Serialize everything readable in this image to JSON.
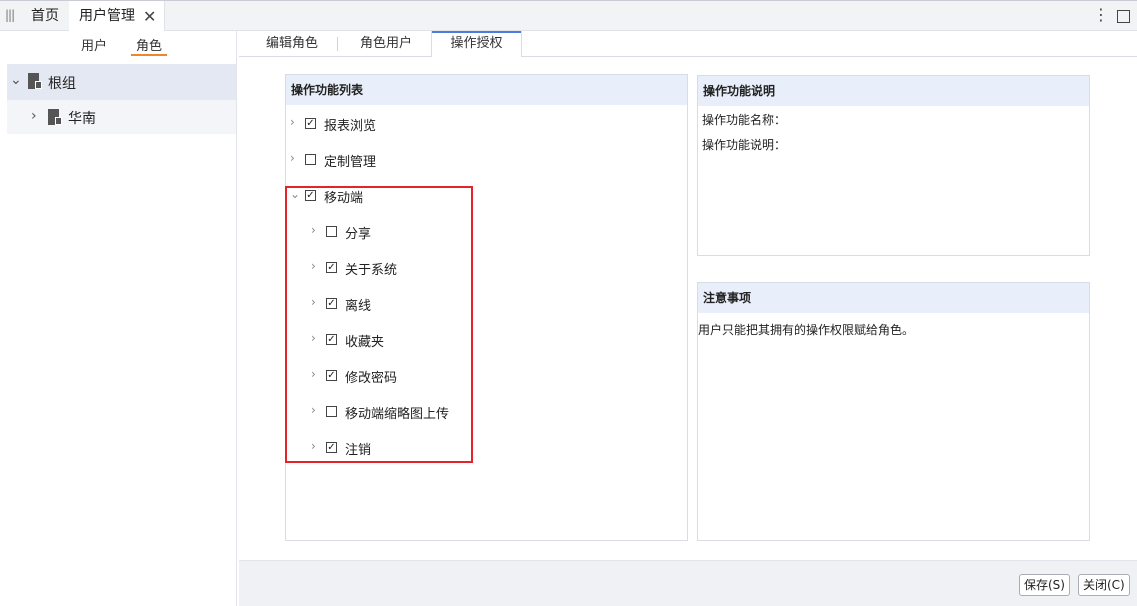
{
  "topbar": {
    "grip_icon": "grip-icon",
    "tabs": [
      {
        "label": "首页"
      },
      {
        "label": "用户管理",
        "close": "✕"
      }
    ],
    "menu_icon": "⋮"
  },
  "left": {
    "subtabs": {
      "users": "用户",
      "roles": "角色"
    },
    "tree": {
      "root": {
        "label": "根组",
        "arrow": "⌄"
      },
      "child": {
        "label": "华南",
        "arrow": "›"
      }
    }
  },
  "content": {
    "tabs": {
      "edit_role": "编辑角色",
      "role_users": "角色用户",
      "permissions": "操作授权"
    },
    "feature_panel": {
      "title": "操作功能列表",
      "items": [
        {
          "label": "报表浏览",
          "checked": "☑",
          "chevron": "›"
        },
        {
          "label": "定制管理",
          "checked": "",
          "chevron": "›"
        },
        {
          "label": "移动端",
          "checked": "☑",
          "chevron": "⌄"
        },
        {
          "label": "分享",
          "checked": "",
          "chevron": "›"
        },
        {
          "label": "关于系统",
          "checked": "☑",
          "chevron": "›"
        },
        {
          "label": "离线",
          "checked": "☑",
          "chevron": "›"
        },
        {
          "label": "收藏夹",
          "checked": "☑",
          "chevron": "›"
        },
        {
          "label": "修改密码",
          "checked": "☑",
          "chevron": "›"
        },
        {
          "label": "移动端缩略图上传",
          "checked": "",
          "chevron": "›"
        },
        {
          "label": "注销",
          "checked": "☑",
          "chevron": "›"
        }
      ]
    },
    "desc_panel": {
      "title": "操作功能说明",
      "name_label": "操作功能名称：",
      "desc_label": "操作功能说明："
    },
    "notice_panel": {
      "title": "注意事项",
      "text": "用户只能把其拥有的操作权限赋给角色。"
    }
  },
  "footer": {
    "save": "保存(S)",
    "close": "关闭(C)"
  },
  "colors": {
    "accent": "#f0862b",
    "highlight": "#e3242b",
    "header_bg": "#e9effa",
    "tab_active": "#4c7ce0"
  }
}
